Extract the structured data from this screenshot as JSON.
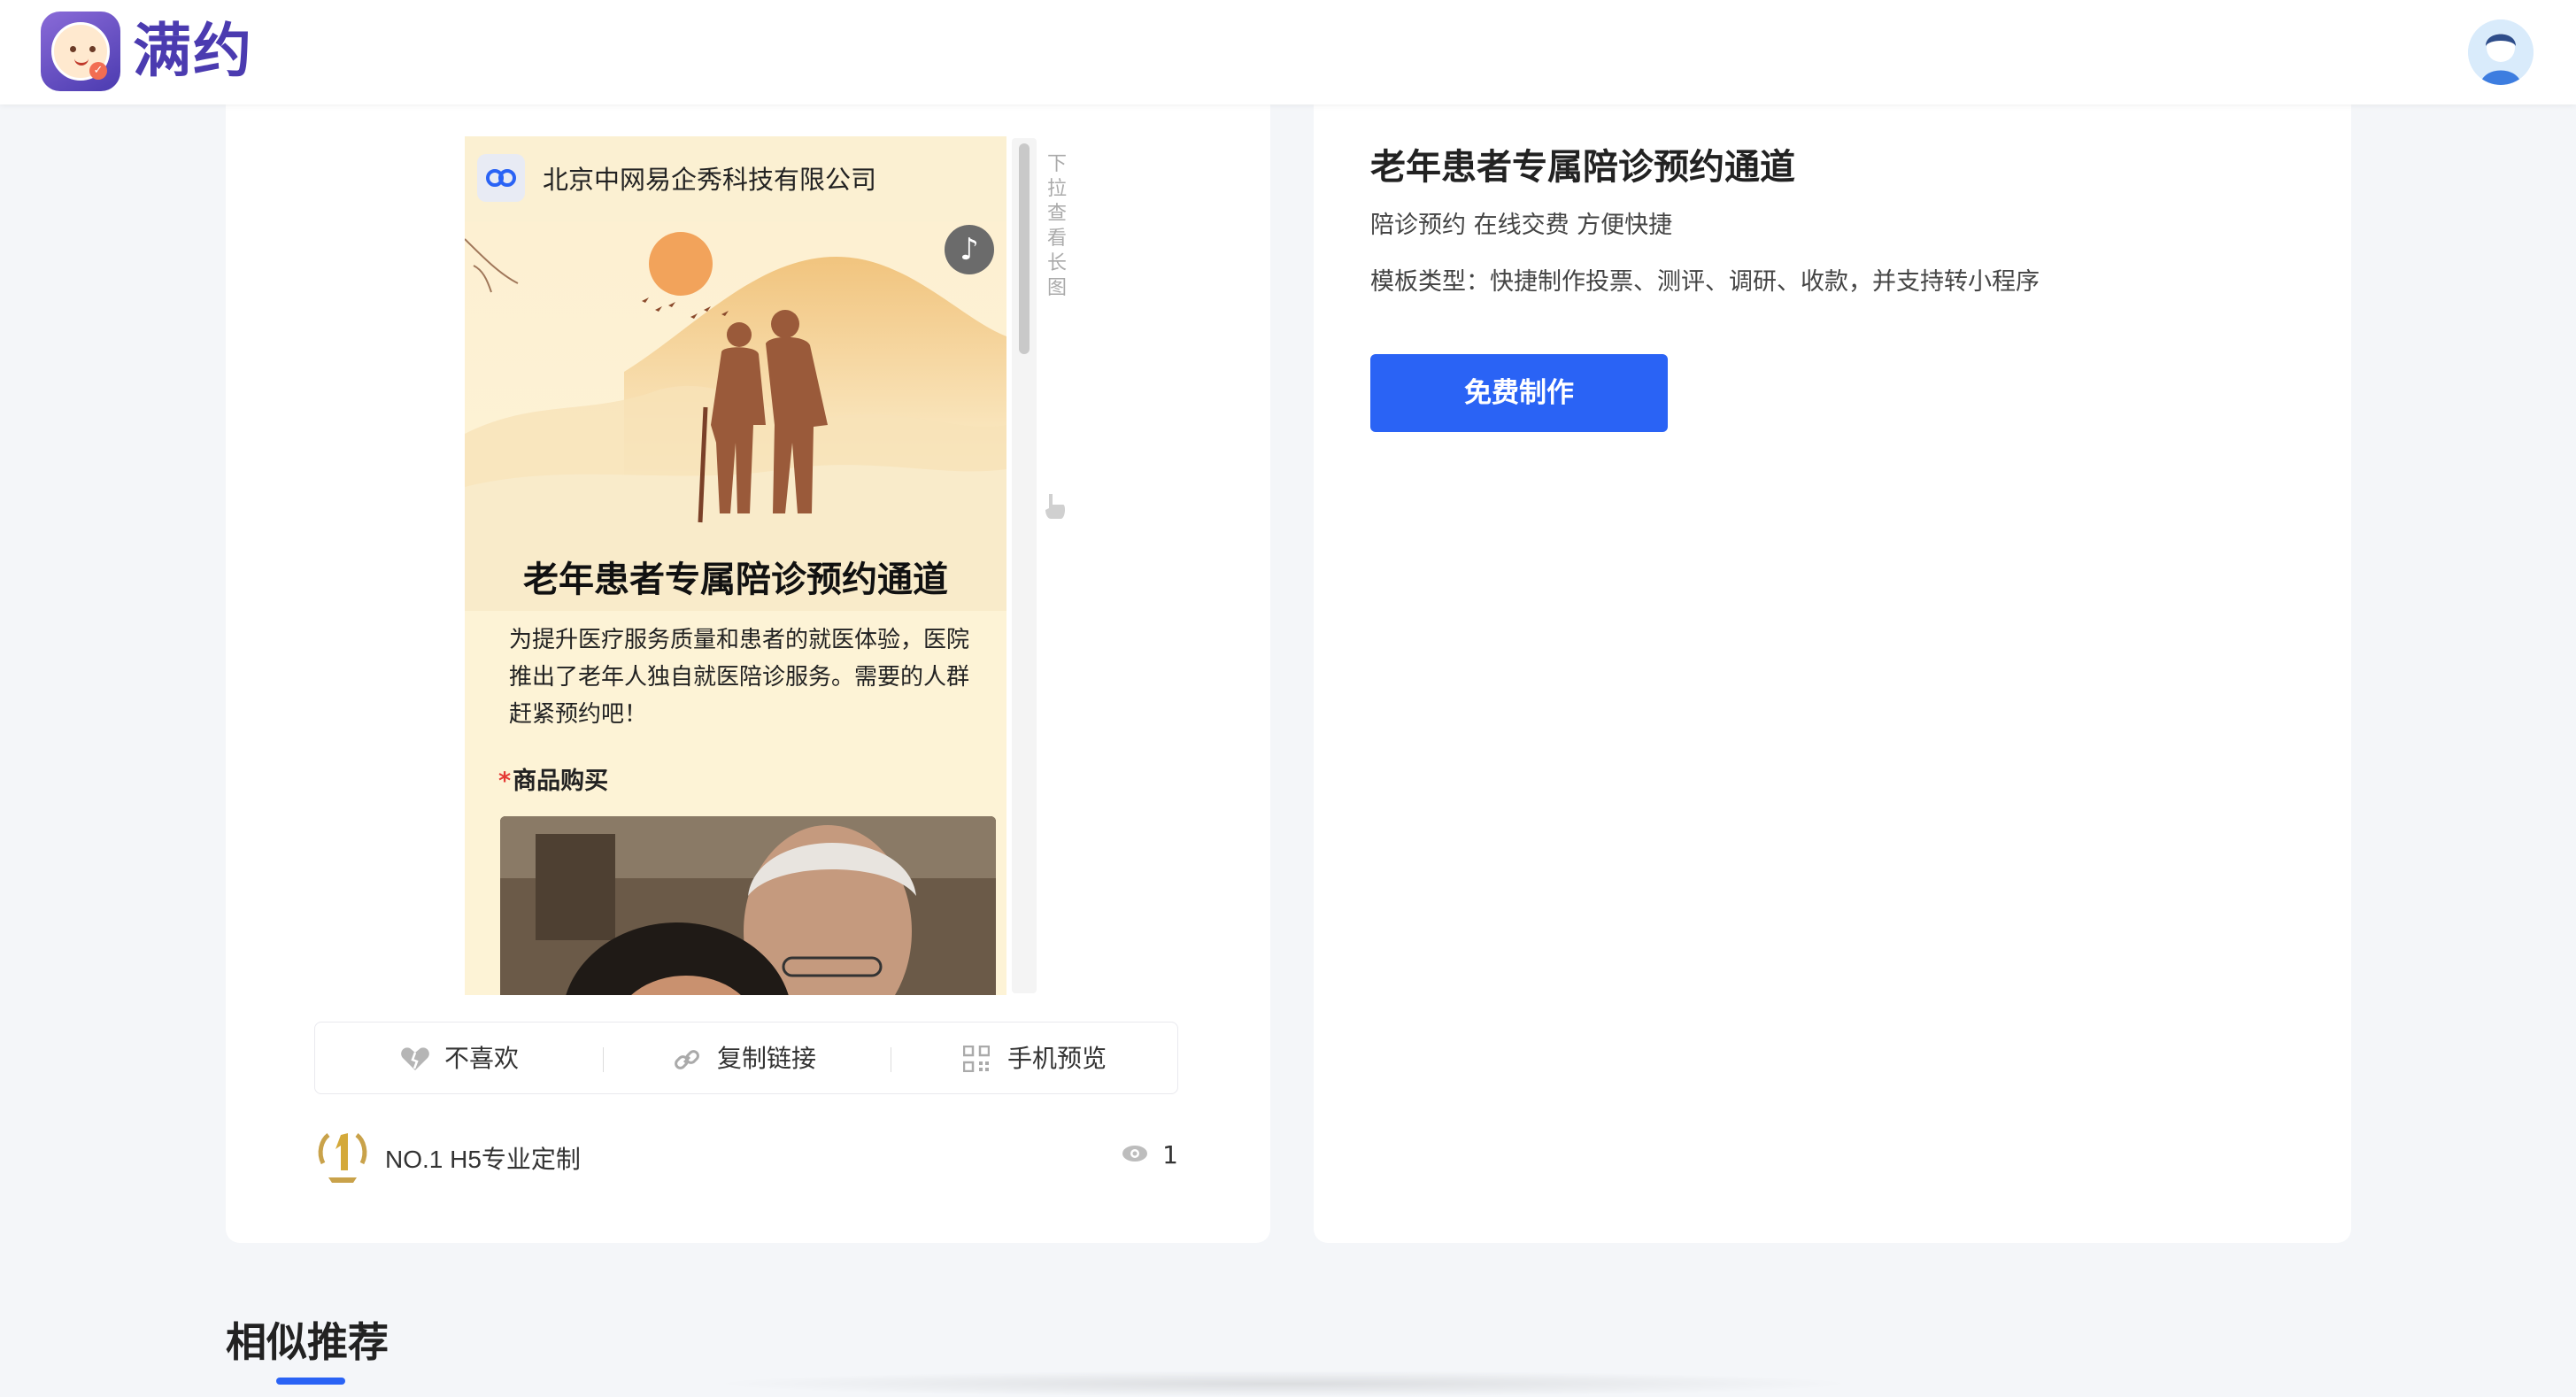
{
  "brand": {
    "logo_text": "满约"
  },
  "preview": {
    "org_name": "北京中网易企秀科技有限公司",
    "title": "老年患者专属陪诊预约通道",
    "description": "为提升医疗服务质量和患者的就医体验，医院推出了老年人独自就医陪诊服务。需要的人群赶紧预约吧！",
    "section_required_mark": "*",
    "section_label": "商品购买",
    "scroll_hint": "下拉查看长图",
    "music_icon": "♪"
  },
  "actions": [
    {
      "label": "不喜欢",
      "icon": "dislike-icon"
    },
    {
      "label": "复制链接",
      "icon": "link-icon"
    },
    {
      "label": "手机预览",
      "icon": "qrcode-icon"
    }
  ],
  "badge": {
    "text": "NO.1 H5专业定制"
  },
  "views": {
    "count": "1"
  },
  "template": {
    "title": "老年患者专属陪诊预约通道",
    "subtitle": "陪诊预约 在线交费 方便快捷",
    "type_text": "模板类型：快捷制作投票、测评、调研、收款，并支持转小程序",
    "cta_label": "免费制作"
  },
  "similar": {
    "title": "相似推荐"
  },
  "colors": {
    "accent": "#2a63f5",
    "brand": "#4b3bb0",
    "preview_bg": "#fdf3d6"
  }
}
